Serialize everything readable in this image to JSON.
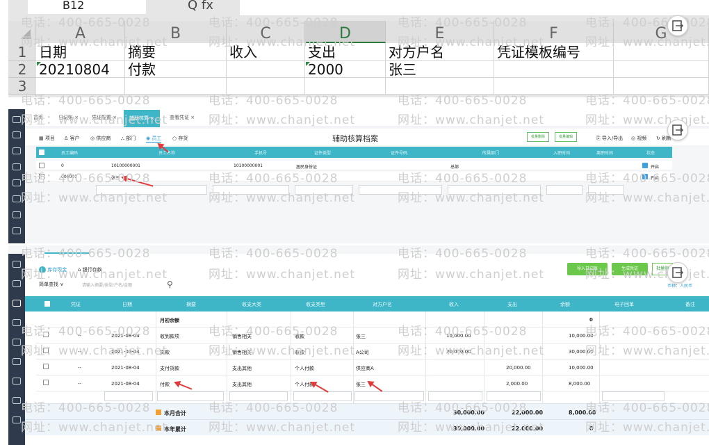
{
  "excel": {
    "namebox": "B12",
    "fx": "Q fx",
    "columns": [
      "A",
      "B",
      "C",
      "D",
      "E",
      "F",
      "G"
    ],
    "rows": [
      "1",
      "2",
      "3"
    ],
    "header_row": [
      "日期",
      "摘要",
      "收入",
      "支出",
      "对方户名",
      "凭证模板编号"
    ],
    "data_row": [
      "20210804",
      "付款",
      "",
      "2000",
      "张三",
      ""
    ]
  },
  "watermarks": {
    "phone": "电话：400-665-0028",
    "site": "网址：www.chanjet.net"
  },
  "mid": {
    "tabs": [
      "首页",
      "日记账 ×",
      "凭证配置 ×",
      "辅助核算 ×",
      "查看凭证 ×"
    ],
    "sub_tabs": [
      "项目",
      "客户",
      "供应商",
      "部门",
      "员工",
      "存货"
    ],
    "title": "辅助核算档案",
    "btn_batch_delete": "批量删除",
    "btn_batch_edit": "批量编辑",
    "links": [
      "导入/导出",
      "视频",
      "刷新"
    ],
    "columns": [
      "员工编码",
      "员工名称",
      "手机号",
      "证件类型",
      "证件号码",
      "所属部门",
      "入职时间",
      "离职时间",
      "状态"
    ],
    "rows": [
      {
        "code": "0",
        "name": "10100000001",
        "phone": "10100000001",
        "idtype": "居民身份证",
        "idno": "",
        "dept": "总部",
        "status": "开启"
      },
      {
        "code": "000001",
        "name": "张三",
        "phone": "",
        "idtype": "",
        "idno": "",
        "dept": "",
        "status": "开启"
      }
    ]
  },
  "bottom": {
    "tabs": [
      "库存现金",
      "银行存款"
    ],
    "search_mode": "简单查找",
    "search_placeholder": "请输入摘要/类型/户名/金额",
    "btn_import": "导入日记账",
    "btn_generate": "生成凭证",
    "btn_batch": "批量删",
    "currency": "币种：人民币",
    "columns": [
      "凭证",
      "日期",
      "摘要",
      "收支大类",
      "收支类型",
      "对方户名",
      "收入",
      "支出",
      "余额",
      "电子回单",
      "备注"
    ],
    "opening": {
      "label": "月初余额",
      "balance": "0"
    },
    "rows": [
      {
        "voucher": "--",
        "date": "2021-08-04",
        "summary": "收到款项",
        "category": "销售相关",
        "type": "收款",
        "party": "张三",
        "income": "10,000.00",
        "expense": "",
        "balance": "10,000.00"
      },
      {
        "voucher": "--",
        "date": "2021-08-04",
        "summary": "货款",
        "category": "销售相关",
        "type": "收款",
        "party": "A公司",
        "income": "20,000.00",
        "expense": "",
        "balance": "30,000.00"
      },
      {
        "voucher": "--",
        "date": "2021-08-04",
        "summary": "支付货款",
        "category": "支出其他",
        "type": "个人付款",
        "party": "供应商A",
        "income": "",
        "expense": "20,000.00",
        "balance": "10,000.00"
      },
      {
        "voucher": "--",
        "date": "2021-08-04",
        "summary": "付款",
        "category": "支出其他",
        "type": "个人付款",
        "party": "张三",
        "income": "",
        "expense": "2,000.00",
        "balance": "8,000.00"
      }
    ],
    "month_total": {
      "label": "本月合计",
      "income": "30,000.00",
      "expense": "22,000.00",
      "balance": "8,000.00"
    },
    "year_total": {
      "label": "本年累计",
      "income": "30,000.00",
      "expense": "22,000.00",
      "balance": "0"
    }
  }
}
